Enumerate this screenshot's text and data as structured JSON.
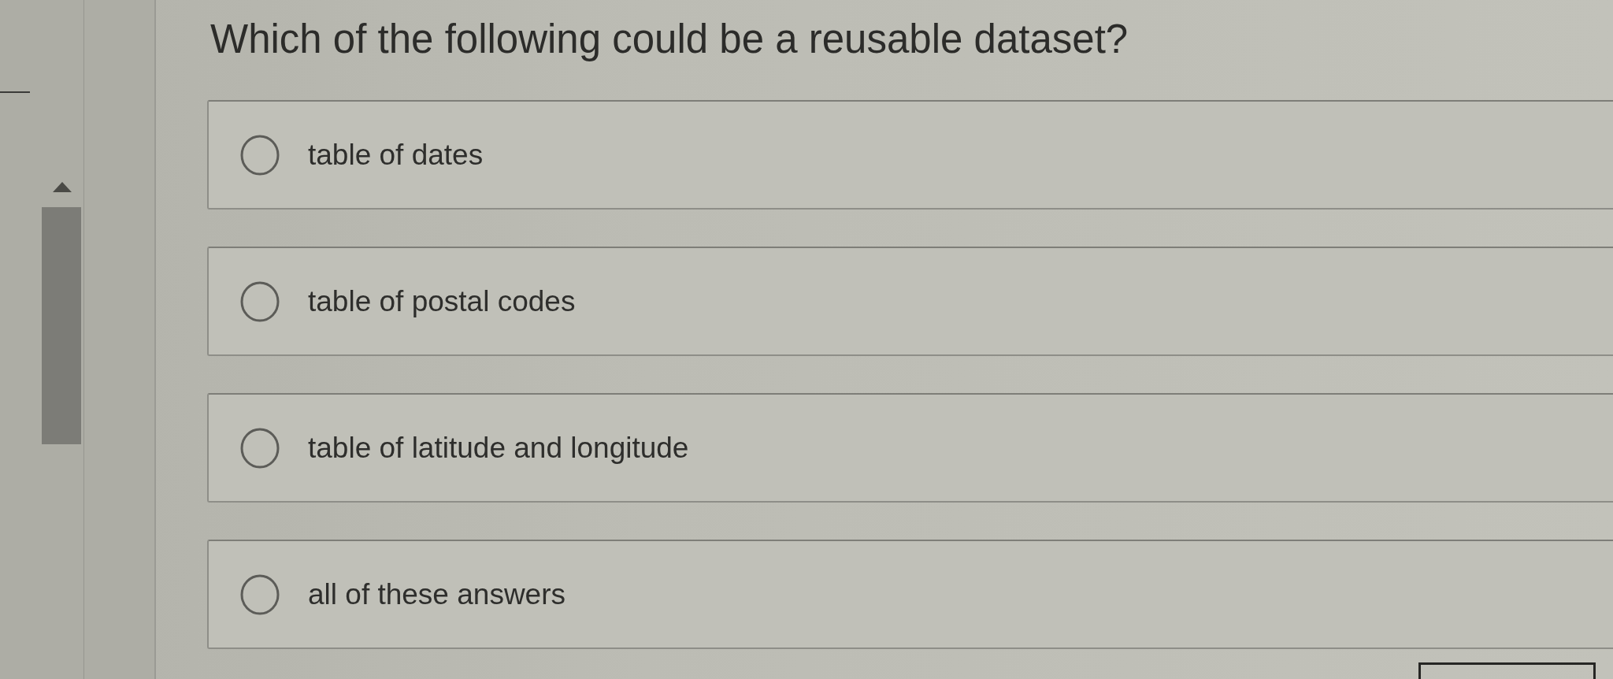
{
  "question": "Which of the following could be a reusable dataset?",
  "options": [
    {
      "label": "table of dates",
      "selected": false
    },
    {
      "label": "table of postal codes",
      "selected": false
    },
    {
      "label": "table of latitude and longitude",
      "selected": false
    },
    {
      "label": "all of these answers",
      "selected": false
    }
  ]
}
